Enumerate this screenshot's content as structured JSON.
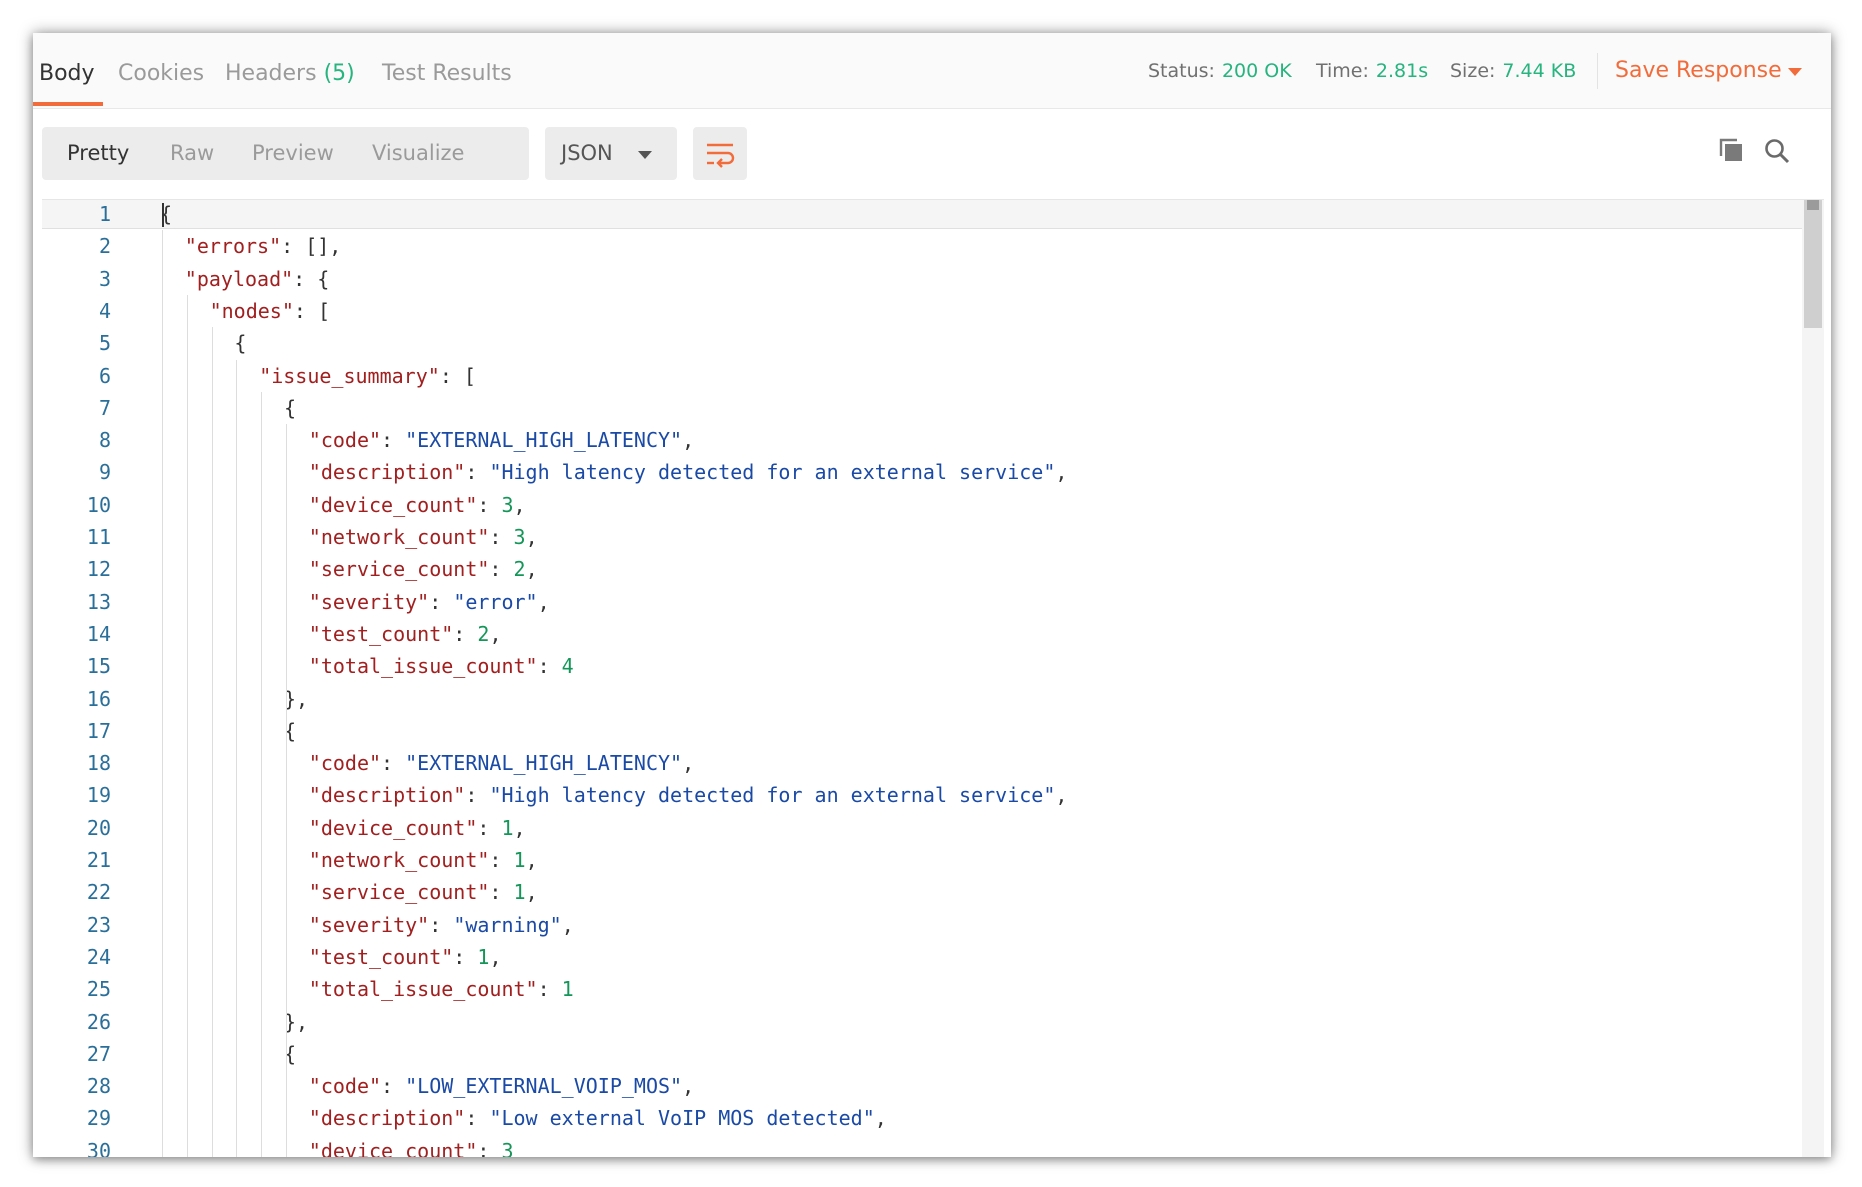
{
  "tabs": [
    {
      "label": "Body",
      "active": true
    },
    {
      "label": "Cookies",
      "active": false
    },
    {
      "label": "Headers",
      "count": "(5)",
      "active": false
    },
    {
      "label": "Test Results",
      "active": false
    }
  ],
  "status": {
    "status_label": "Status:",
    "status_value": "200 OK",
    "time_label": "Time:",
    "time_value": "2.81s",
    "size_label": "Size:",
    "size_value": "7.44 KB"
  },
  "save_response": "Save Response",
  "view_modes": [
    "Pretty",
    "Raw",
    "Preview",
    "Visualize"
  ],
  "active_view_mode": "Pretty",
  "format": "JSON",
  "icons": {
    "wrap": "wrap-lines-icon",
    "copy": "copy-icon",
    "search": "search-icon",
    "dropdown": "chevron-down-icon"
  },
  "colors": {
    "accent": "#f26b3a",
    "success": "#26b47f",
    "json_key": "#a11f1f",
    "json_string": "#1a4aa6",
    "json_number": "#159659",
    "line_number": "#2a6f9a"
  },
  "code_lines": [
    {
      "num": "1",
      "indent": 0,
      "tokens": [
        [
          "p",
          "{"
        ]
      ]
    },
    {
      "num": "2",
      "indent": 1,
      "tokens": [
        [
          "k",
          "\"errors\""
        ],
        [
          "p",
          ": [],"
        ]
      ]
    },
    {
      "num": "3",
      "indent": 1,
      "tokens": [
        [
          "k",
          "\"payload\""
        ],
        [
          "p",
          ": {"
        ]
      ]
    },
    {
      "num": "4",
      "indent": 2,
      "tokens": [
        [
          "k",
          "\"nodes\""
        ],
        [
          "p",
          ": ["
        ]
      ]
    },
    {
      "num": "5",
      "indent": 3,
      "tokens": [
        [
          "p",
          "{"
        ]
      ]
    },
    {
      "num": "6",
      "indent": 4,
      "tokens": [
        [
          "k",
          "\"issue_summary\""
        ],
        [
          "p",
          ": ["
        ]
      ]
    },
    {
      "num": "7",
      "indent": 5,
      "tokens": [
        [
          "p",
          "{"
        ]
      ]
    },
    {
      "num": "8",
      "indent": 6,
      "tokens": [
        [
          "k",
          "\"code\""
        ],
        [
          "p",
          ": "
        ],
        [
          "s",
          "\"EXTERNAL_HIGH_LATENCY\""
        ],
        [
          "p",
          ","
        ]
      ]
    },
    {
      "num": "9",
      "indent": 6,
      "tokens": [
        [
          "k",
          "\"description\""
        ],
        [
          "p",
          ": "
        ],
        [
          "s",
          "\"High latency detected for an external service\""
        ],
        [
          "p",
          ","
        ]
      ]
    },
    {
      "num": "10",
      "indent": 6,
      "tokens": [
        [
          "k",
          "\"device_count\""
        ],
        [
          "p",
          ": "
        ],
        [
          "n",
          "3"
        ],
        [
          "p",
          ","
        ]
      ]
    },
    {
      "num": "11",
      "indent": 6,
      "tokens": [
        [
          "k",
          "\"network_count\""
        ],
        [
          "p",
          ": "
        ],
        [
          "n",
          "3"
        ],
        [
          "p",
          ","
        ]
      ]
    },
    {
      "num": "12",
      "indent": 6,
      "tokens": [
        [
          "k",
          "\"service_count\""
        ],
        [
          "p",
          ": "
        ],
        [
          "n",
          "2"
        ],
        [
          "p",
          ","
        ]
      ]
    },
    {
      "num": "13",
      "indent": 6,
      "tokens": [
        [
          "k",
          "\"severity\""
        ],
        [
          "p",
          ": "
        ],
        [
          "s",
          "\"error\""
        ],
        [
          "p",
          ","
        ]
      ]
    },
    {
      "num": "14",
      "indent": 6,
      "tokens": [
        [
          "k",
          "\"test_count\""
        ],
        [
          "p",
          ": "
        ],
        [
          "n",
          "2"
        ],
        [
          "p",
          ","
        ]
      ]
    },
    {
      "num": "15",
      "indent": 6,
      "tokens": [
        [
          "k",
          "\"total_issue_count\""
        ],
        [
          "p",
          ": "
        ],
        [
          "n",
          "4"
        ]
      ]
    },
    {
      "num": "16",
      "indent": 5,
      "tokens": [
        [
          "p",
          "},"
        ]
      ]
    },
    {
      "num": "17",
      "indent": 5,
      "tokens": [
        [
          "p",
          "{"
        ]
      ]
    },
    {
      "num": "18",
      "indent": 6,
      "tokens": [
        [
          "k",
          "\"code\""
        ],
        [
          "p",
          ": "
        ],
        [
          "s",
          "\"EXTERNAL_HIGH_LATENCY\""
        ],
        [
          "p",
          ","
        ]
      ]
    },
    {
      "num": "19",
      "indent": 6,
      "tokens": [
        [
          "k",
          "\"description\""
        ],
        [
          "p",
          ": "
        ],
        [
          "s",
          "\"High latency detected for an external service\""
        ],
        [
          "p",
          ","
        ]
      ]
    },
    {
      "num": "20",
      "indent": 6,
      "tokens": [
        [
          "k",
          "\"device_count\""
        ],
        [
          "p",
          ": "
        ],
        [
          "n",
          "1"
        ],
        [
          "p",
          ","
        ]
      ]
    },
    {
      "num": "21",
      "indent": 6,
      "tokens": [
        [
          "k",
          "\"network_count\""
        ],
        [
          "p",
          ": "
        ],
        [
          "n",
          "1"
        ],
        [
          "p",
          ","
        ]
      ]
    },
    {
      "num": "22",
      "indent": 6,
      "tokens": [
        [
          "k",
          "\"service_count\""
        ],
        [
          "p",
          ": "
        ],
        [
          "n",
          "1"
        ],
        [
          "p",
          ","
        ]
      ]
    },
    {
      "num": "23",
      "indent": 6,
      "tokens": [
        [
          "k",
          "\"severity\""
        ],
        [
          "p",
          ": "
        ],
        [
          "s",
          "\"warning\""
        ],
        [
          "p",
          ","
        ]
      ]
    },
    {
      "num": "24",
      "indent": 6,
      "tokens": [
        [
          "k",
          "\"test_count\""
        ],
        [
          "p",
          ": "
        ],
        [
          "n",
          "1"
        ],
        [
          "p",
          ","
        ]
      ]
    },
    {
      "num": "25",
      "indent": 6,
      "tokens": [
        [
          "k",
          "\"total_issue_count\""
        ],
        [
          "p",
          ": "
        ],
        [
          "n",
          "1"
        ]
      ]
    },
    {
      "num": "26",
      "indent": 5,
      "tokens": [
        [
          "p",
          "},"
        ]
      ]
    },
    {
      "num": "27",
      "indent": 5,
      "tokens": [
        [
          "p",
          "{"
        ]
      ]
    },
    {
      "num": "28",
      "indent": 6,
      "tokens": [
        [
          "k",
          "\"code\""
        ],
        [
          "p",
          ": "
        ],
        [
          "s",
          "\"LOW_EXTERNAL_VOIP_MOS\""
        ],
        [
          "p",
          ","
        ]
      ]
    },
    {
      "num": "29",
      "indent": 6,
      "tokens": [
        [
          "k",
          "\"description\""
        ],
        [
          "p",
          ": "
        ],
        [
          "s",
          "\"Low external VoIP MOS detected\""
        ],
        [
          "p",
          ","
        ]
      ]
    },
    {
      "num": "30",
      "indent": 6,
      "tokens": [
        [
          "k",
          "\"device_count\""
        ],
        [
          "p",
          ": "
        ],
        [
          "n",
          "3"
        ]
      ]
    }
  ]
}
